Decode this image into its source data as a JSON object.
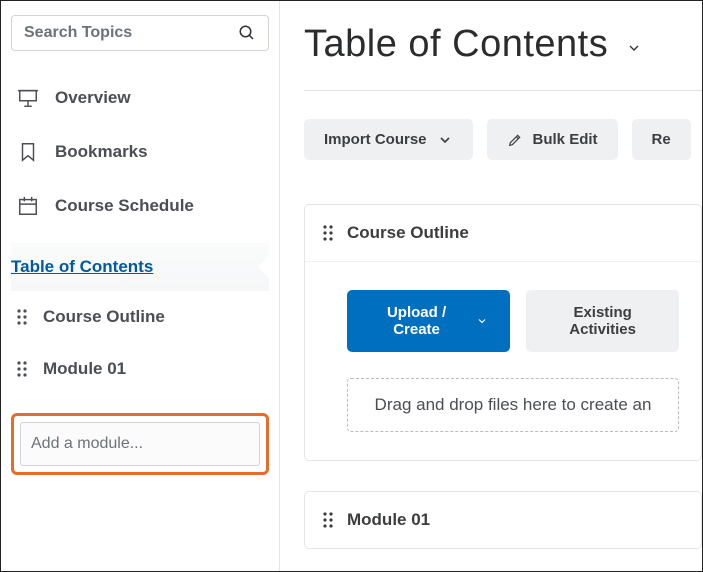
{
  "search": {
    "placeholder": "Search Topics"
  },
  "sidebar": {
    "items": [
      {
        "label": "Overview"
      },
      {
        "label": "Bookmarks"
      },
      {
        "label": "Course Schedule"
      }
    ],
    "toc_label": "Table of Contents",
    "modules": [
      {
        "label": "Course Outline"
      },
      {
        "label": "Module 01"
      }
    ],
    "add_module_placeholder": "Add a module..."
  },
  "main": {
    "title": "Table of Contents",
    "toolbar": {
      "import_label": "Import Course",
      "bulk_edit_label": "Bulk Edit",
      "third_label": "Re"
    },
    "course_outline": {
      "header": "Course Outline",
      "upload_label": "Upload / Create",
      "existing_label": "Existing Activities",
      "dropzone_text": "Drag and drop files here to create an"
    },
    "module01": {
      "header": "Module 01"
    }
  }
}
